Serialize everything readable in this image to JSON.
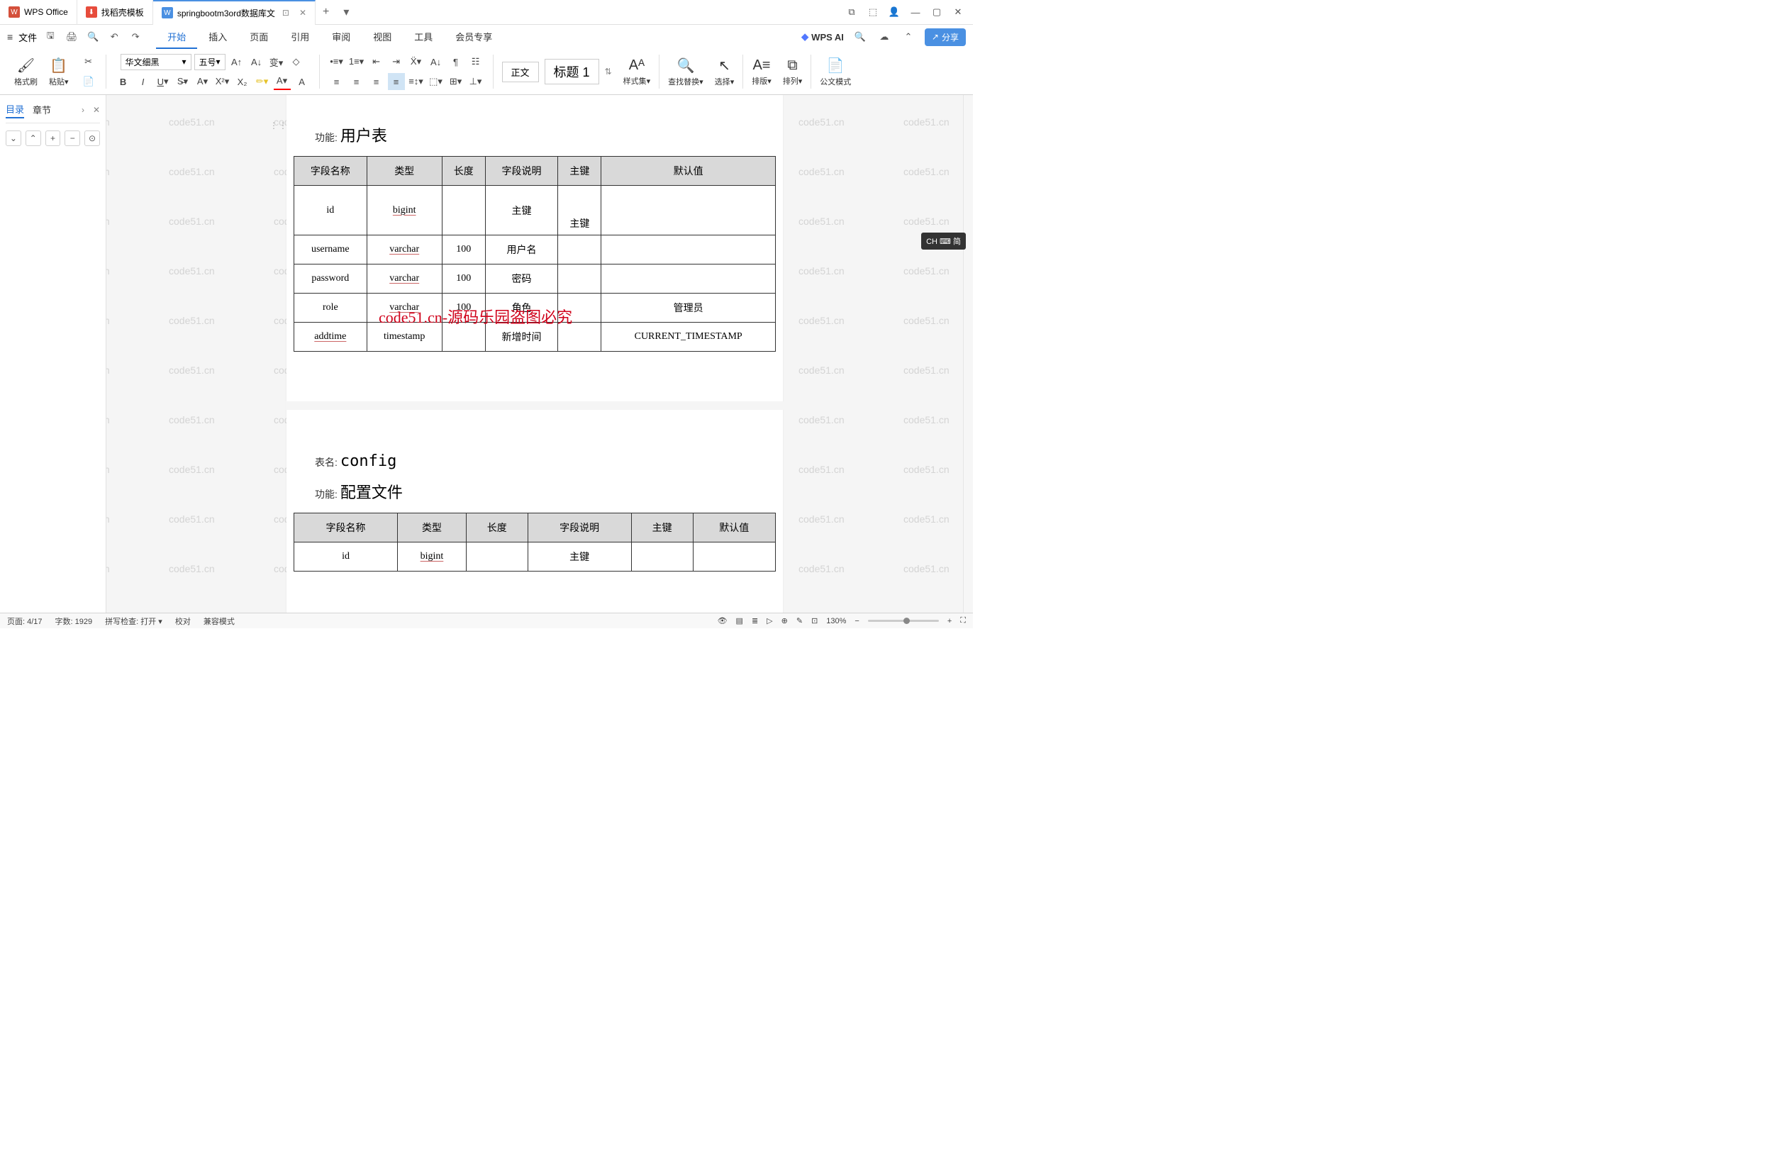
{
  "titleBar": {
    "appName": "WPS Office",
    "tab2": "找稻壳模板",
    "activeTab": "springbootm3ord数据库文",
    "addTab": "+"
  },
  "menuBar": {
    "file": "文件",
    "tabs": [
      "开始",
      "插入",
      "页面",
      "引用",
      "审阅",
      "视图",
      "工具",
      "会员专享"
    ],
    "activeTab": "开始",
    "wpsai": "WPS AI",
    "share": "分享"
  },
  "ribbon": {
    "formatBrush": "格式刷",
    "paste": "粘贴",
    "font": "华文细黑",
    "size": "五号",
    "styleNormal": "正文",
    "styleHeading": "标题 1",
    "styleSet": "样式集",
    "findReplace": "查找替换",
    "select": "选择",
    "arrangeV": "排版",
    "arrangeH": "排列",
    "officialMode": "公文模式"
  },
  "toc": {
    "tab1": "目录",
    "tab2": "章节"
  },
  "document": {
    "watermark": "code51.cn",
    "overlay": "code51.cn-源码乐园盗图必究",
    "funcLabel": "功能:",
    "tableNameLabel": "表名:",
    "section1": {
      "funcValue": "用户表"
    },
    "section2": {
      "tableNameValue": "config",
      "funcValue": "配置文件"
    },
    "headers": [
      "字段名称",
      "类型",
      "长度",
      "字段说明",
      "主键",
      "默认值"
    ],
    "table1": {
      "rows": [
        {
          "name": "id",
          "type": "bigint",
          "len": "",
          "desc": "主键",
          "pk": "主键",
          "def": "",
          "nameU": false,
          "typeU": true
        },
        {
          "name": "username",
          "type": "varchar",
          "len": "100",
          "desc": "用户名",
          "pk": "",
          "def": "",
          "nameU": false,
          "typeU": true
        },
        {
          "name": "password",
          "type": "varchar",
          "len": "100",
          "desc": "密码",
          "pk": "",
          "def": "",
          "nameU": false,
          "typeU": true
        },
        {
          "name": "role",
          "type": "varchar",
          "len": "100",
          "desc": "角色",
          "pk": "",
          "def": "管理员",
          "nameU": false,
          "typeU": true
        },
        {
          "name": "addtime",
          "type": "timestamp",
          "len": "",
          "desc": "新增时间",
          "pk": "",
          "def": "CURRENT_TIMESTAMP",
          "nameU": true,
          "typeU": false
        }
      ]
    },
    "table2": {
      "rows": [
        {
          "name": "id",
          "type": "bigint",
          "len": "",
          "desc": "主键",
          "pk": "",
          "def": "",
          "nameU": false,
          "typeU": true
        }
      ]
    }
  },
  "statusBar": {
    "page": "页面: 4/17",
    "words": "字数: 1929",
    "spell": "拼写检查: 打开",
    "proof": "校对",
    "compat": "兼容模式",
    "zoom": "130%"
  },
  "ime": "CH ⌨ 简"
}
